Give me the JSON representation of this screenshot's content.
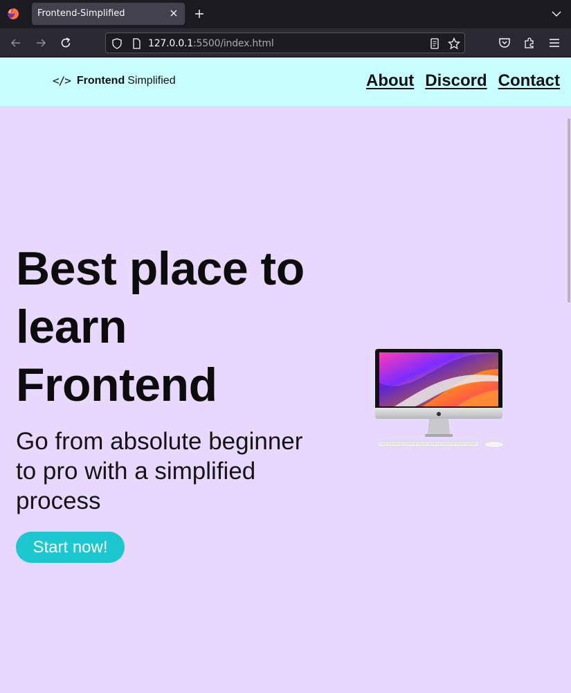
{
  "browser": {
    "tab_title": "Frontend-Simplified",
    "url_host": "127.0.0.1",
    "url_rest": ":5500/index.html"
  },
  "header": {
    "logo_mark": "</>",
    "logo_bold": "Frontend",
    "logo_light": "Simplified",
    "nav": [
      {
        "label": "About"
      },
      {
        "label": "Discord"
      },
      {
        "label": "Contact"
      }
    ]
  },
  "hero": {
    "title_line1": "Best place to",
    "title_line2": "learn",
    "title_line3": "Frontend",
    "subtitle": "Go from absolute beginner to pro with a simplified process",
    "cta_label": "Start now!"
  },
  "colors": {
    "header_bg": "#c8fefe",
    "page_bg": "#e8d8fd",
    "accent": "#1cc7cf"
  },
  "icons": [
    "firefox-logo-icon",
    "close-icon",
    "plus-icon",
    "chevron-down-icon",
    "back-arrow-icon",
    "forward-arrow-icon",
    "reload-icon",
    "shield-icon",
    "page-icon",
    "reader-view-icon",
    "star-icon",
    "pocket-icon",
    "extensions-icon",
    "menu-icon",
    "imac-illustration"
  ]
}
